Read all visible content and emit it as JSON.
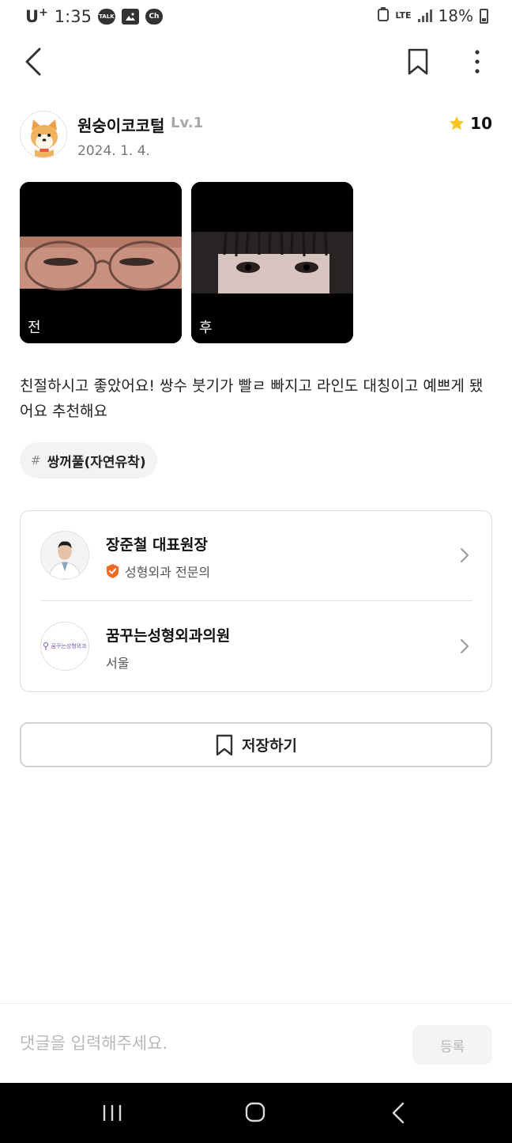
{
  "status_bar": {
    "carrier": "U",
    "carrier_plus": "+",
    "time": "1:35",
    "app_icons": [
      "talk-icon",
      "gallery-icon",
      "channel-icon"
    ],
    "talk_label": "TALK",
    "channel_label": "Ch",
    "network": "LTE",
    "battery_percent": "18%"
  },
  "author": {
    "name": "원숭이코코털",
    "level": "Lv.1",
    "date": "2024. 1. 4.",
    "rating": "10"
  },
  "photos": [
    {
      "label": "전"
    },
    {
      "label": "후"
    }
  ],
  "review": {
    "text": "친절하시고 좋았어요! 쌍수 붓기가 빨ㄹ 빠지고 라인도 대칭이고 예쁘게 됐어요 추천해요"
  },
  "tag": {
    "hash": "#",
    "label": "쌍꺼풀(자연유착)"
  },
  "doctor": {
    "name": "장준철 대표원장",
    "specialty": "성형외과 전문의"
  },
  "clinic": {
    "name": "꿈꾸는성형외과의원",
    "location": "서울",
    "logo_text": "꿈꾸는성형외과"
  },
  "save_button": {
    "label": "저장하기"
  },
  "comment": {
    "placeholder": "댓글을 입력해주세요.",
    "submit_label": "등록"
  },
  "colors": {
    "star": "#ffc31e",
    "verified_badge": "#f26a21",
    "accent_text": "#111111"
  }
}
